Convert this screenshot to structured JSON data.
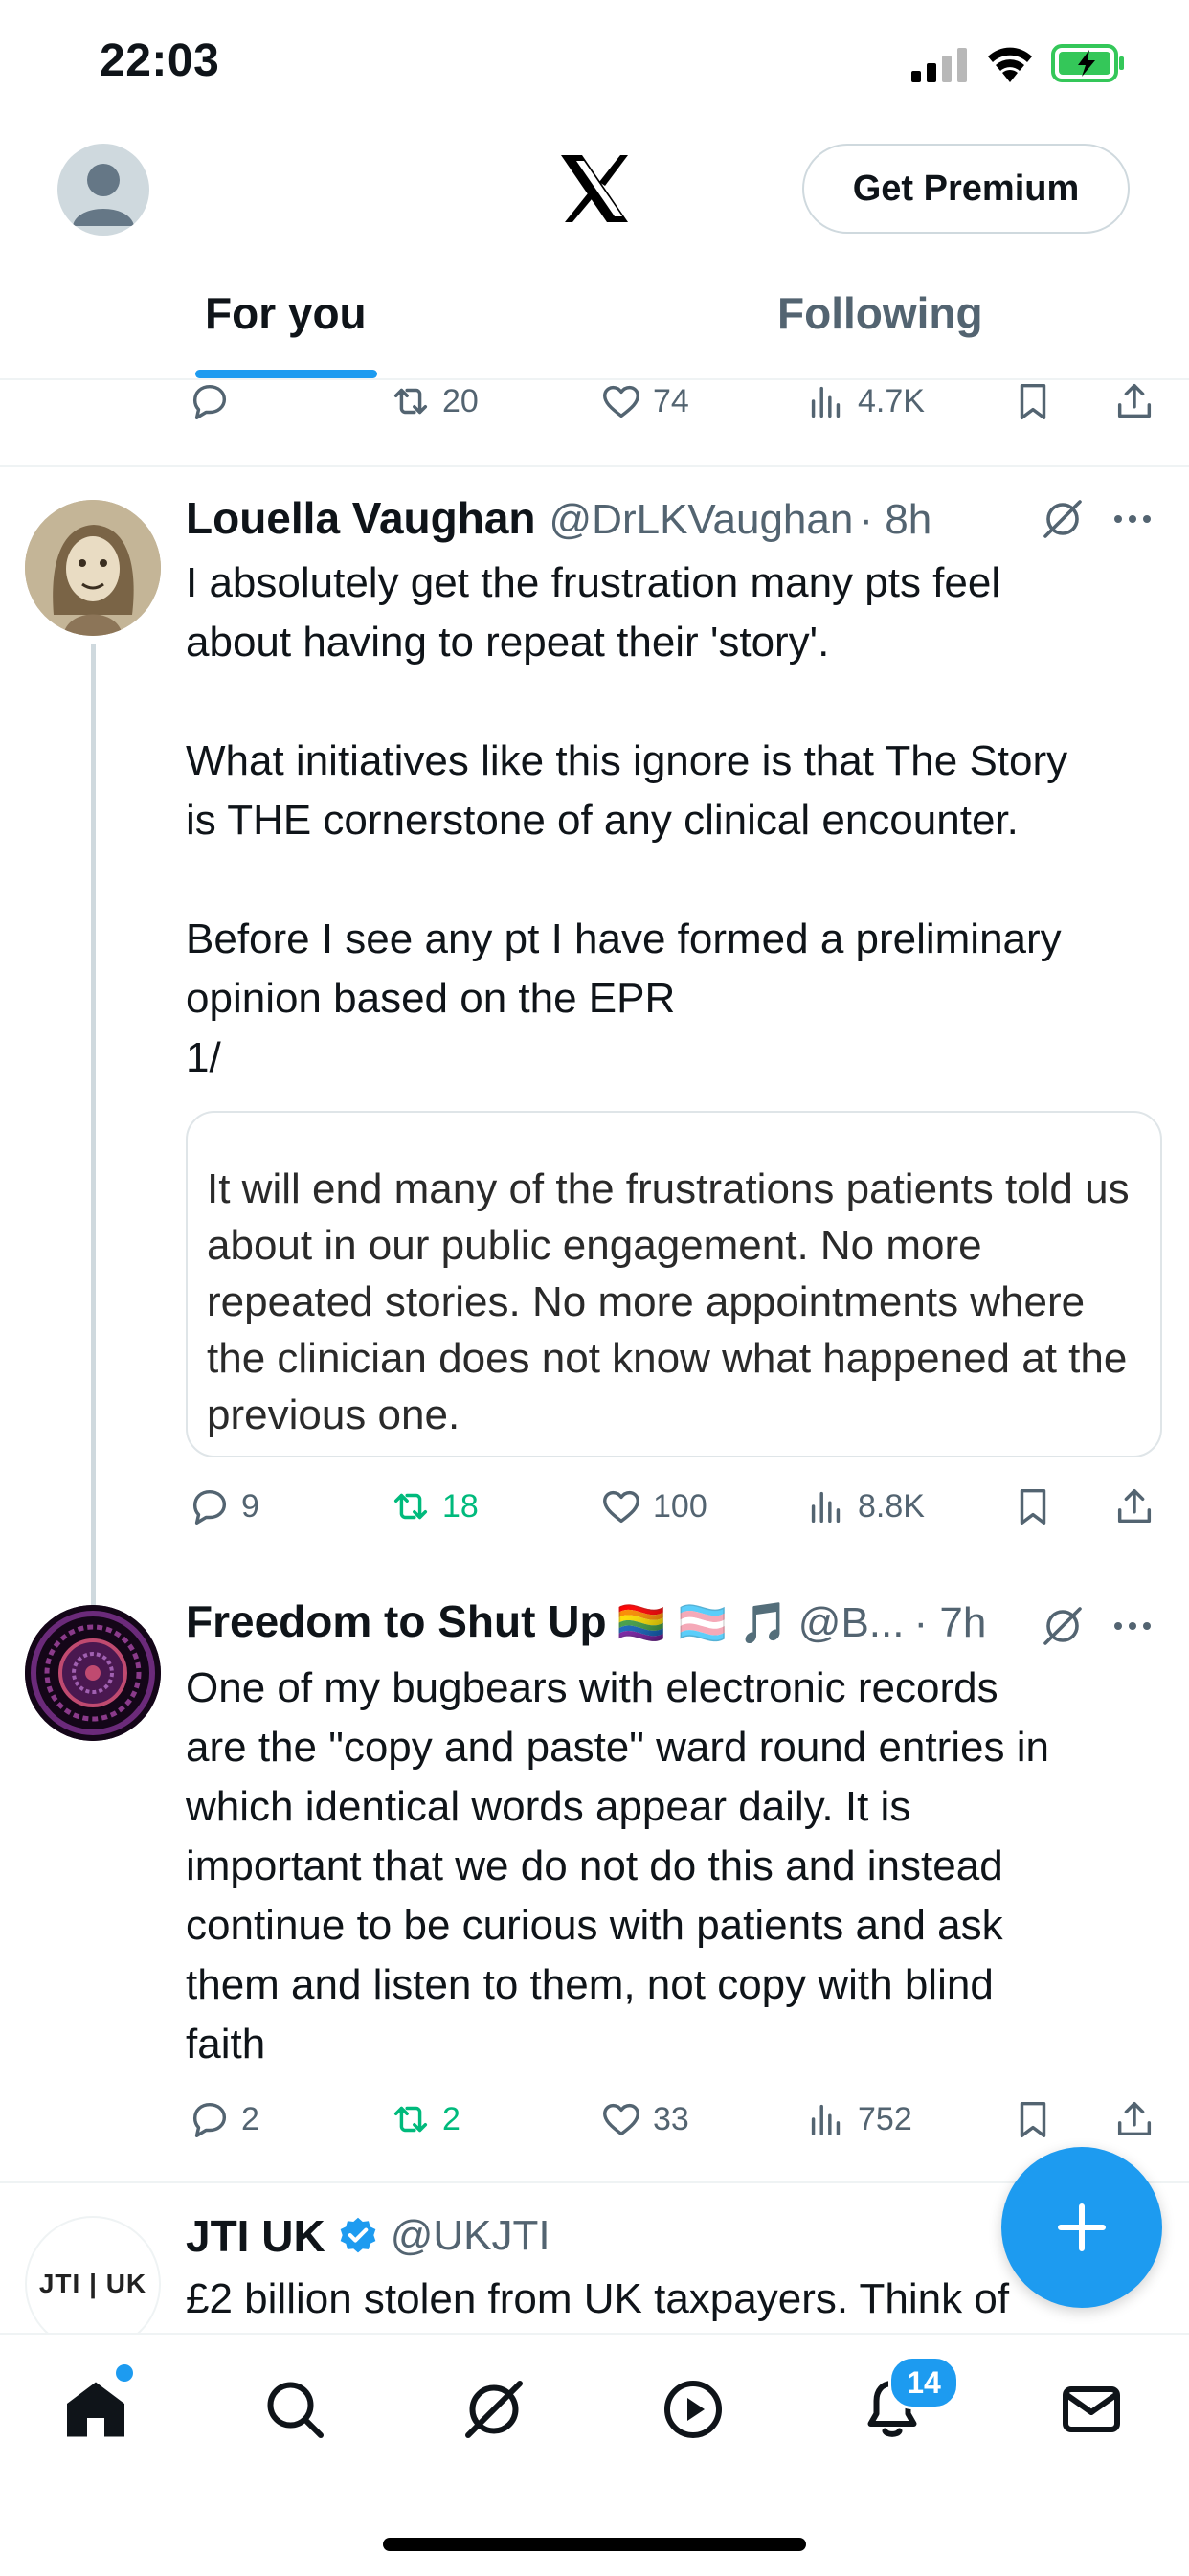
{
  "status_bar": {
    "time": "22:03"
  },
  "header": {
    "premium_label": "Get Premium"
  },
  "tabs": [
    {
      "label": "For you",
      "active": true
    },
    {
      "label": "Following",
      "active": false
    }
  ],
  "prev_post_actions": {
    "replies": "",
    "reposts": "20",
    "likes": "74",
    "views": "4.7K"
  },
  "posts": [
    {
      "name": "Louella Vaughan",
      "handle": "@DrLKVaughan",
      "time": "· 8h",
      "text": "I absolutely get the frustration many pts feel\nabout having to repeat their 'story'.\n\nWhat initiatives like this ignore is that The Story\nis THE cornerstone of any clinical encounter.\n\nBefore I see any pt I have formed a preliminary\nopinion based on the EPR\n1/",
      "media_text": "It will end many of the frustrations patients told us about in our public engagement. No more repeated stories. No more appointments where the clinician does not know what happened at the previous one.",
      "actions": {
        "replies": "9",
        "reposts": "18",
        "likes": "100",
        "views": "8.8K"
      }
    },
    {
      "name": "Freedom to Shut Up",
      "emoji": "🏳️‍🌈 🏳️‍⚧️ 🎵",
      "handle": "@B...",
      "time": "· 7h",
      "text": "One of my bugbears with electronic records\nare the \"copy and paste\" ward round entries in\nwhich identical words appear daily. It is\nimportant that we do not do this and instead\ncontinue to be curious with patients and ask\nthem and listen to them, not copy with blind\nfaith",
      "actions": {
        "replies": "2",
        "reposts": "2",
        "likes": "33",
        "views": "752"
      }
    },
    {
      "name": "JTI UK",
      "handle": "@UKJTI",
      "avatar_text": "JTI | UK",
      "text": "£2 billion stolen from UK taxpayers. Think of"
    }
  ],
  "notifications_badge": "14",
  "colors": {
    "accent": "#1d9bf0",
    "repost_active": "#00ba7c",
    "muted": "#536471"
  }
}
